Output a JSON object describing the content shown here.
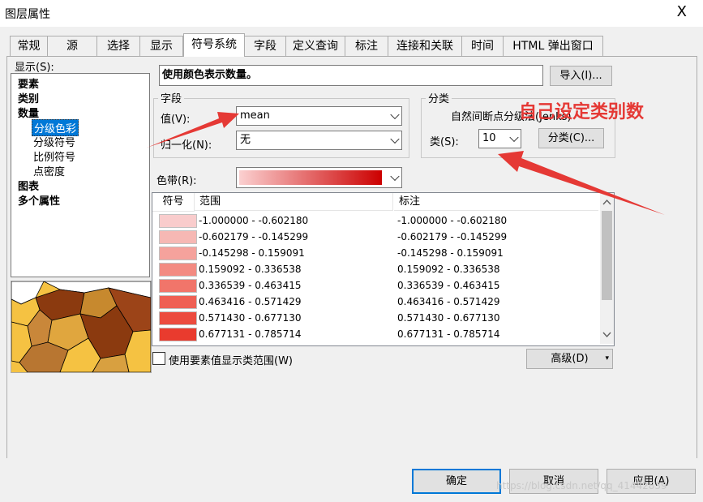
{
  "window": {
    "title": "图层属性",
    "close_glyph": "X"
  },
  "tabs": [
    "常规",
    "源",
    "选择",
    "显示",
    "符号系统",
    "字段",
    "定义查询",
    "标注",
    "连接和关联",
    "时间",
    "HTML 弹出窗口"
  ],
  "active_tab": "符号系统",
  "show_label": "显示(S):",
  "tree": [
    {
      "label": "要素",
      "bold": true
    },
    {
      "label": "类别",
      "bold": true
    },
    {
      "label": "数量",
      "bold": true
    },
    {
      "label": "分级色彩",
      "bold": false,
      "selected": true
    },
    {
      "label": "分级符号",
      "bold": false
    },
    {
      "label": "比例符号",
      "bold": false
    },
    {
      "label": "点密度",
      "bold": false
    },
    {
      "label": "图表",
      "bold": true
    },
    {
      "label": "多个属性",
      "bold": true
    }
  ],
  "description": "使用颜色表示数量。",
  "import_button": "导入(I)...",
  "fields": {
    "title": "字段",
    "value_label": "值(V):",
    "value": "mean",
    "normalize_label": "归一化(N):",
    "normalize": "无"
  },
  "classification": {
    "title": "分类",
    "method": "自然间断点分级法(Jenks)",
    "classes_label": "类(S):",
    "classes": "10",
    "classify_button": "分类(C)..."
  },
  "color_ramp_label": "色带(R):",
  "color_ramp": {
    "from": "#fbd0d0",
    "to": "#cc0000"
  },
  "table": {
    "headers": [
      "符号",
      "范围",
      "标注"
    ],
    "rows": [
      {
        "color": "#f9cccc",
        "range": "-1.000000 - -0.602180",
        "label": "-1.000000 - -0.602180"
      },
      {
        "color": "#f6b8b4",
        "range": "-0.602179 - -0.145299",
        "label": "-0.602179 - -0.145299"
      },
      {
        "color": "#f5a29c",
        "range": "-0.145298 - 0.159091",
        "label": "-0.145298 - 0.159091"
      },
      {
        "color": "#f38b82",
        "range": "0.159092 - 0.336538",
        "label": "0.159092 - 0.336538"
      },
      {
        "color": "#f1756a",
        "range": "0.336539 - 0.463415",
        "label": "0.336539 - 0.463415"
      },
      {
        "color": "#ef5f53",
        "range": "0.463416 - 0.571429",
        "label": "0.463416 - 0.571429"
      },
      {
        "color": "#ec4b3e",
        "range": "0.571430 - 0.677130",
        "label": "0.571430 - 0.677130"
      },
      {
        "color": "#e93b2e",
        "range": "0.677131 - 0.785714",
        "label": "0.677131 - 0.785714"
      }
    ]
  },
  "show_feature_values": "使用要素值显示类范围(W)",
  "advanced_button": "高级(D)",
  "ok_button": "确定",
  "cancel_button": "取消",
  "apply_button": "应用(A)",
  "annotation": "自己设定类别数",
  "watermark": "https://blog.csdn.net/qq_41442839"
}
